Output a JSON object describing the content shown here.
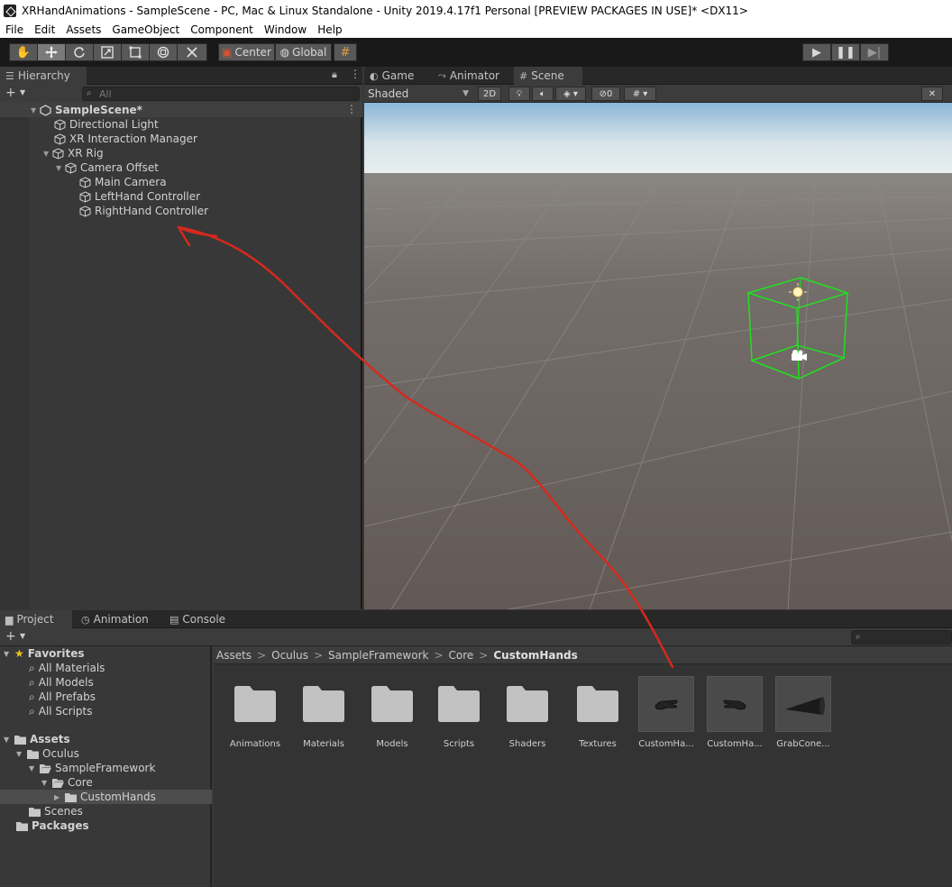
{
  "window": {
    "title": "XRHandAnimations - SampleScene - PC, Mac & Linux Standalone - Unity 2019.4.17f1 Personal [PREVIEW PACKAGES IN USE]* <DX11>"
  },
  "menu": [
    "File",
    "Edit",
    "Assets",
    "GameObject",
    "Component",
    "Window",
    "Help"
  ],
  "toolbar": {
    "pivot_label": "Center",
    "space_label": "Global"
  },
  "hierarchy": {
    "tab_label": "Hierarchy",
    "add_label": "+",
    "search_placeholder": "All",
    "scene_name": "SampleScene*",
    "items": [
      {
        "label": "Directional Light"
      },
      {
        "label": "XR Interaction Manager"
      },
      {
        "label": "XR Rig"
      },
      {
        "label": "Camera Offset"
      },
      {
        "label": "Main Camera"
      },
      {
        "label": "LeftHand Controller"
      },
      {
        "label": "RightHand Controller"
      }
    ]
  },
  "scene": {
    "tabs": [
      "Game",
      "Animator",
      "Scene"
    ],
    "shading_mode": "Shaded",
    "mode_2d_label": "2D",
    "hidden_count": "0"
  },
  "project": {
    "tabs": [
      "Project",
      "Animation",
      "Console"
    ],
    "add_label": "+",
    "tree": {
      "favorites_label": "Favorites",
      "favorites": [
        "All Materials",
        "All Models",
        "All Prefabs",
        "All Scripts"
      ],
      "assets_label": "Assets",
      "oculus": "Oculus",
      "sample_framework": "SampleFramework",
      "core": "Core",
      "custom_hands": "CustomHands",
      "scenes": "Scenes",
      "packages_label": "Packages"
    },
    "breadcrumb": [
      "Assets",
      "Oculus",
      "SampleFramework",
      "Core",
      "CustomHands"
    ],
    "breadcrumb_sep": ">",
    "assets": [
      {
        "label": "Animations"
      },
      {
        "label": "Materials"
      },
      {
        "label": "Models"
      },
      {
        "label": "Scripts"
      },
      {
        "label": "Shaders"
      },
      {
        "label": "Textures"
      },
      {
        "label": "CustomHa..."
      },
      {
        "label": "CustomHa..."
      },
      {
        "label": "GrabCone..."
      }
    ]
  },
  "colors": {
    "annotation_stroke": "#d42a1e",
    "gizmo_green": "#20e020"
  }
}
